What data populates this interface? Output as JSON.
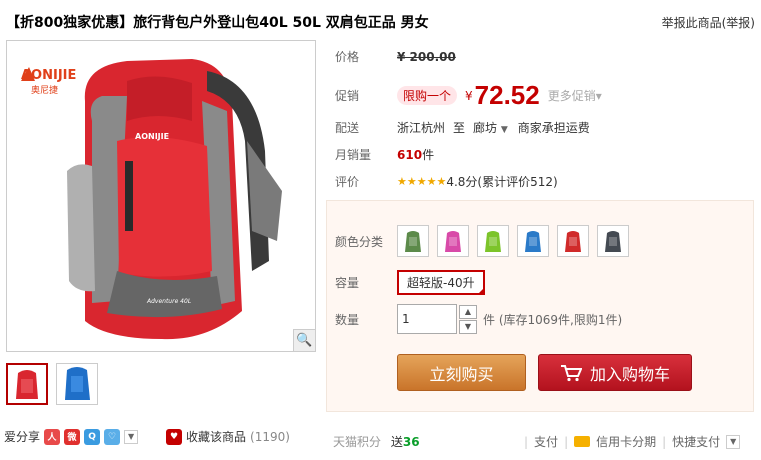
{
  "header": {
    "title": "【折800独家优惠】旅行背包户外登山包40L 50L 双肩包正品 男女",
    "report_link": "举报此商品(举报)"
  },
  "gallery": {
    "brand_logo": "AONIJIE",
    "brand_logo_cn": "奥尼捷",
    "bag_print": "Adventure 40L",
    "zoom_icon": "magnifier-icon",
    "thumbnails": [
      {
        "color": "#d9262f",
        "active": true
      },
      {
        "color": "#1f6fc8",
        "active": false
      }
    ]
  },
  "info": {
    "price_label": "价格",
    "original_price": "¥ 200.00",
    "promo_label": "促销",
    "limit_badge": "限购一个",
    "currency": "¥",
    "promo_price": "72.52",
    "more_promo": "更多促销",
    "shipping_label": "配送",
    "ship_from": "浙江杭州",
    "ship_to_word": "至",
    "ship_to": "廊坊",
    "shipping_fee": "商家承担运费",
    "monthly_label": "月销量",
    "monthly_value": "610",
    "monthly_unit": "件",
    "rating_label": "评价",
    "stars": "★★★★★",
    "rating_score": "4.8分",
    "review_count": "(累计评价512)"
  },
  "sku": {
    "color_label": "颜色分类",
    "colors": [
      "#5c8a4a",
      "#d84aa8",
      "#7cc42a",
      "#2a7ac8",
      "#d02a2a",
      "#444a52"
    ],
    "capacity_label": "容量",
    "capacity_selected": "超轻版-40升",
    "quantity_label": "数量",
    "quantity_value": "1",
    "stock_text": "件 (库存1069件,限购1件)"
  },
  "actions": {
    "buy_now": "立刻购买",
    "add_to_cart": "加入购物车"
  },
  "share": {
    "label": "爱分享",
    "favorite": "收藏该商品",
    "favorite_count": "(1190)"
  },
  "footer": {
    "points_label": "天猫积分",
    "points_give": "送",
    "points_value": "36",
    "pay_label": "支付",
    "credit_card": "信用卡分期",
    "quick_pay": "快捷支付"
  },
  "colors": {
    "accent_red": "#c40000",
    "buy_orange": "#d0802e",
    "cart_red": "#c41a26"
  }
}
